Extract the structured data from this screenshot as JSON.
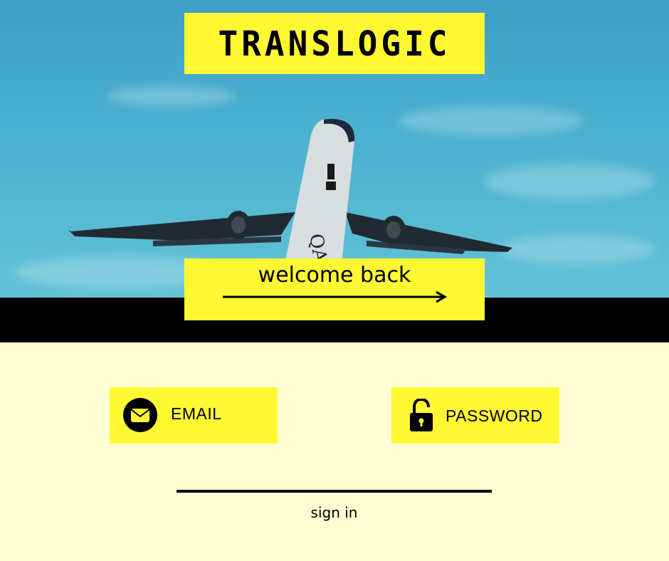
{
  "brand": {
    "name": "TRANSLOGIC"
  },
  "hero": {
    "welcome_label": "welcome back",
    "plane_livery": "QAT"
  },
  "form": {
    "email_label": "EMAIL",
    "password_label": "PASSWORD",
    "signin_label": "sign in"
  },
  "icons": {
    "email": "envelope-icon",
    "password": "lock-icon",
    "welcome_arrow": "arrow-right-icon"
  },
  "colors": {
    "accent_yellow": "#fff833",
    "cream_background": "#fffdd3",
    "band_black": "#000000",
    "sky_blue": "#48aecf"
  }
}
